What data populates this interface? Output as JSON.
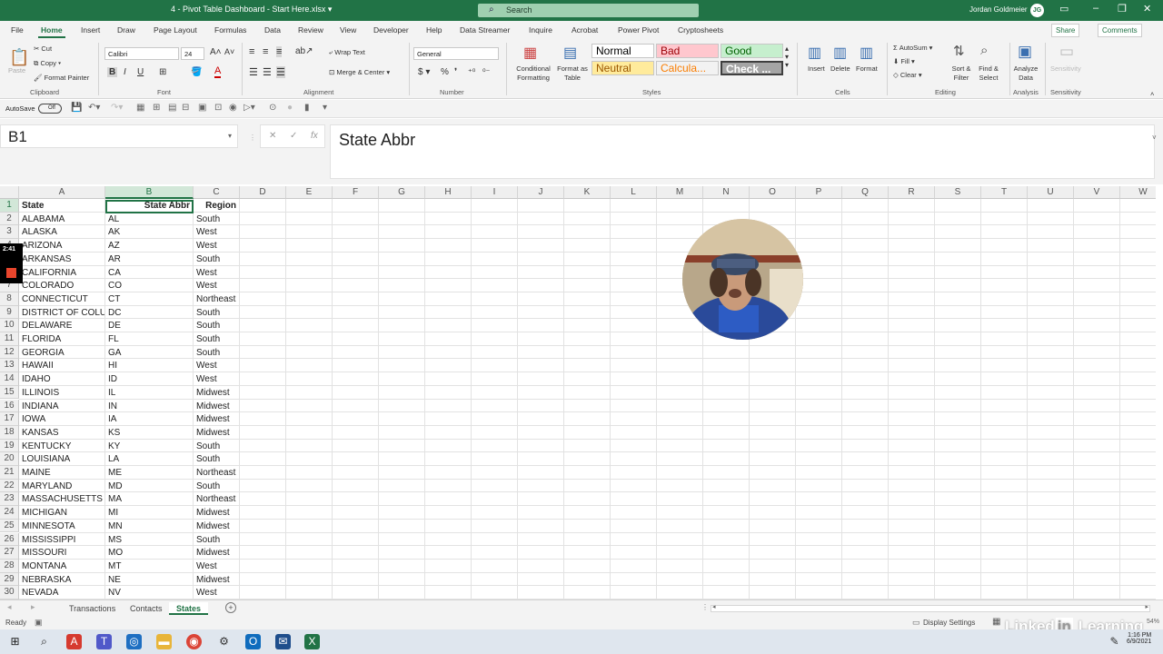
{
  "titlebar": {
    "filename": "4 - Pivot Table Dashboard - Start Here.xlsx  ▾",
    "search_placeholder": "Search",
    "user_name": "Jordan Goldmeier",
    "user_initials": "JG"
  },
  "menu_tabs": [
    "File",
    "Home",
    "Insert",
    "Draw",
    "Page Layout",
    "Formulas",
    "Data",
    "Review",
    "View",
    "Developer",
    "Help",
    "Data Streamer",
    "Inquire",
    "Acrobat",
    "Power Pivot",
    "Cryptosheets"
  ],
  "active_tab": "Home",
  "share_label": "Share",
  "comments_label": "Comments",
  "ribbon": {
    "paste": "Paste",
    "cut": "Cut",
    "copy": "Copy",
    "format_painter": "Format Painter",
    "clipboard_group": "Clipboard",
    "font_name": "Calibri",
    "font_size": "24",
    "font_group": "Font",
    "wrap_text": "Wrap Text",
    "merge_center": "Merge & Center",
    "alignment_group": "Alignment",
    "number_format": "General",
    "number_group": "Number",
    "cond_format": "Conditional Formatting",
    "format_table": "Format as Table",
    "style_normal": "Normal",
    "style_bad": "Bad",
    "style_good": "Good",
    "style_neutral": "Neutral",
    "style_calc": "Calcula...",
    "style_check": "Check ...",
    "styles_group": "Styles",
    "insert": "Insert",
    "delete": "Delete",
    "format": "Format",
    "cells_group": "Cells",
    "autosum": "AutoSum",
    "fill": "Fill",
    "clear": "Clear",
    "sort_filter": "Sort & Filter",
    "find_select": "Find & Select",
    "editing_group": "Editing",
    "analyze_data": "Analyze Data",
    "analysis_group": "Analysis",
    "sensitivity": "Sensitivity",
    "sensitivity_group": "Sensitivity"
  },
  "qat": {
    "autosave": "AutoSave",
    "toggle": "Off"
  },
  "name_box": "B1",
  "formula_value": "State Abbr",
  "columns": [
    "A",
    "B",
    "C",
    "D",
    "E",
    "F",
    "G",
    "H",
    "I",
    "J",
    "K",
    "L",
    "M",
    "N",
    "O",
    "P",
    "Q",
    "R",
    "S",
    "T",
    "U",
    "V",
    "W"
  ],
  "selected_column": "B",
  "rows": [
    [
      "State",
      "State Abbr",
      "Region"
    ],
    [
      "ALABAMA",
      "AL",
      "South"
    ],
    [
      "ALASKA",
      "AK",
      "West"
    ],
    [
      "ARIZONA",
      "AZ",
      "West"
    ],
    [
      "ARKANSAS",
      "AR",
      "South"
    ],
    [
      "CALIFORNIA",
      "CA",
      "West"
    ],
    [
      "COLORADO",
      "CO",
      "West"
    ],
    [
      "CONNECTICUT",
      "CT",
      "Northeast"
    ],
    [
      "DISTRICT OF COLUMBIA",
      "DC",
      "South"
    ],
    [
      "DELAWARE",
      "DE",
      "South"
    ],
    [
      "FLORIDA",
      "FL",
      "South"
    ],
    [
      "GEORGIA",
      "GA",
      "South"
    ],
    [
      "HAWAII",
      "HI",
      "West"
    ],
    [
      "IDAHO",
      "ID",
      "West"
    ],
    [
      "ILLINOIS",
      "IL",
      "Midwest"
    ],
    [
      "INDIANA",
      "IN",
      "Midwest"
    ],
    [
      "IOWA",
      "IA",
      "Midwest"
    ],
    [
      "KANSAS",
      "KS",
      "Midwest"
    ],
    [
      "KENTUCKY",
      "KY",
      "South"
    ],
    [
      "LOUISIANA",
      "LA",
      "South"
    ],
    [
      "MAINE",
      "ME",
      "Northeast"
    ],
    [
      "MARYLAND",
      "MD",
      "South"
    ],
    [
      "MASSACHUSETTS",
      "MA",
      "Northeast"
    ],
    [
      "MICHIGAN",
      "MI",
      "Midwest"
    ],
    [
      "MINNESOTA",
      "MN",
      "Midwest"
    ],
    [
      "MISSISSIPPI",
      "MS",
      "South"
    ],
    [
      "MISSOURI",
      "MO",
      "Midwest"
    ],
    [
      "MONTANA",
      "MT",
      "West"
    ],
    [
      "NEBRASKA",
      "NE",
      "Midwest"
    ],
    [
      "NEVADA",
      "NV",
      "West"
    ]
  ],
  "sheet_tabs": [
    "Transactions",
    "Contacts",
    "States"
  ],
  "active_sheet": "States",
  "status": {
    "ready": "Ready",
    "display_settings": "Display Settings",
    "zoom": "54%"
  },
  "recording_time": "2:41",
  "watermark": {
    "pre": "Linked",
    "in": "in",
    "post": " Learning"
  },
  "taskbar_clock": {
    "time": "1:16 PM",
    "date": "6/9/2021"
  },
  "colors": {
    "excel_green": "#217346",
    "style_bad_bg": "#ffc7ce",
    "style_good_bg": "#c6efce",
    "style_neutral_bg": "#ffeb9c",
    "record_red": "#e8452c"
  }
}
